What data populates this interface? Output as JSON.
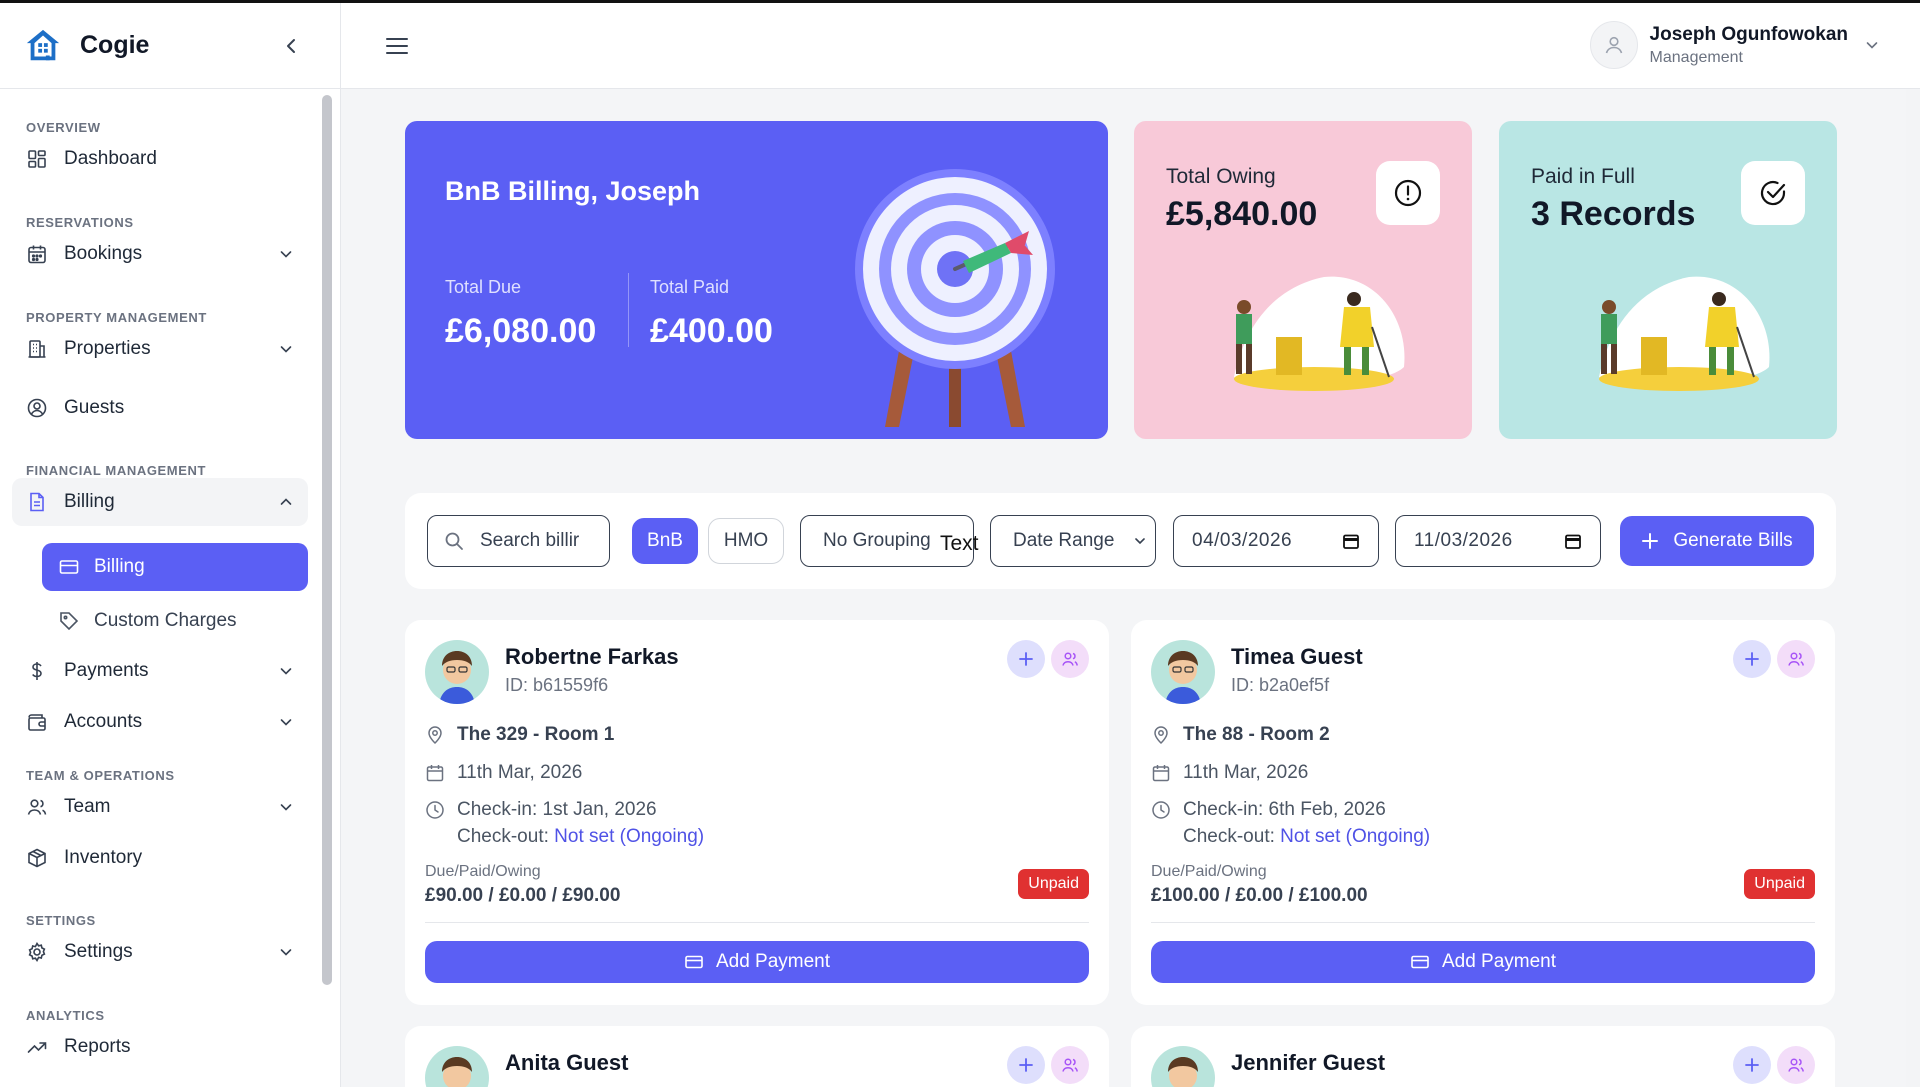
{
  "app": {
    "name": "Cogie"
  },
  "colors": {
    "primary": "#5b5ff4",
    "owing_card": "#f8c9d8",
    "paid_card": "#b9e6e4",
    "unpaid": "#e03131"
  },
  "sidebar": {
    "sections": {
      "overview": "OVERVIEW",
      "reservations": "RESERVATIONS",
      "property": "PROPERTY MANAGEMENT",
      "financial": "FINANCIAL MANAGEMENT",
      "team": "TEAM & OPERATIONS",
      "settings": "SETTINGS",
      "analytics": "ANALYTICS"
    },
    "items": {
      "dashboard": "Dashboard",
      "bookings": "Bookings",
      "properties": "Properties",
      "guests": "Guests",
      "billing": "Billing",
      "billing_sub": "Billing",
      "custom_charges": "Custom Charges",
      "payments": "Payments",
      "accounts": "Accounts",
      "team": "Team",
      "inventory": "Inventory",
      "settings": "Settings",
      "reports": "Reports"
    }
  },
  "header": {
    "user_name": "Joseph Ogunfowokan",
    "user_role": "Management"
  },
  "hero": {
    "title": "BnB Billing, Joseph",
    "total_due_label": "Total Due",
    "total_due": "£6,080.00",
    "total_paid_label": "Total Paid",
    "total_paid": "£400.00"
  },
  "stats": {
    "owing_label": "Total Owing",
    "owing_value": "£5,840.00",
    "paid_label": "Paid in Full",
    "paid_value": "3 Records"
  },
  "filters": {
    "search_placeholder": "Search billir",
    "tab_bnb": "BnB",
    "tab_hmo": "HMO",
    "grouping": "No Grouping",
    "grouping_overflow": "Text",
    "date_range": "Date Range",
    "date_from": "04/03/2026",
    "date_to": "11/03/2026",
    "generate": "Generate Bills"
  },
  "guests": [
    {
      "name": "Robertne Farkas",
      "id": "ID: b61559f6",
      "property": "The 329 - Room 1",
      "date": "11th Mar, 2026",
      "checkin": "Check-in: 1st Jan, 2026",
      "checkout_label": "Check-out:",
      "checkout_value": "Not set (Ongoing)",
      "dpo_label": "Due/Paid/Owing",
      "dpo_value": "£90.00 / £0.00 / £90.00",
      "status": "Unpaid",
      "action": "Add Payment"
    },
    {
      "name": "Timea Guest",
      "id": "ID: b2a0ef5f",
      "property": "The 88 - Room 2",
      "date": "11th Mar, 2026",
      "checkin": "Check-in: 6th Feb, 2026",
      "checkout_label": "Check-out:",
      "checkout_value": "Not set (Ongoing)",
      "dpo_label": "Due/Paid/Owing",
      "dpo_value": "£100.00 / £0.00 / £100.00",
      "status": "Unpaid",
      "action": "Add Payment"
    },
    {
      "name": "Anita Guest"
    },
    {
      "name": "Jennifer Guest"
    }
  ]
}
